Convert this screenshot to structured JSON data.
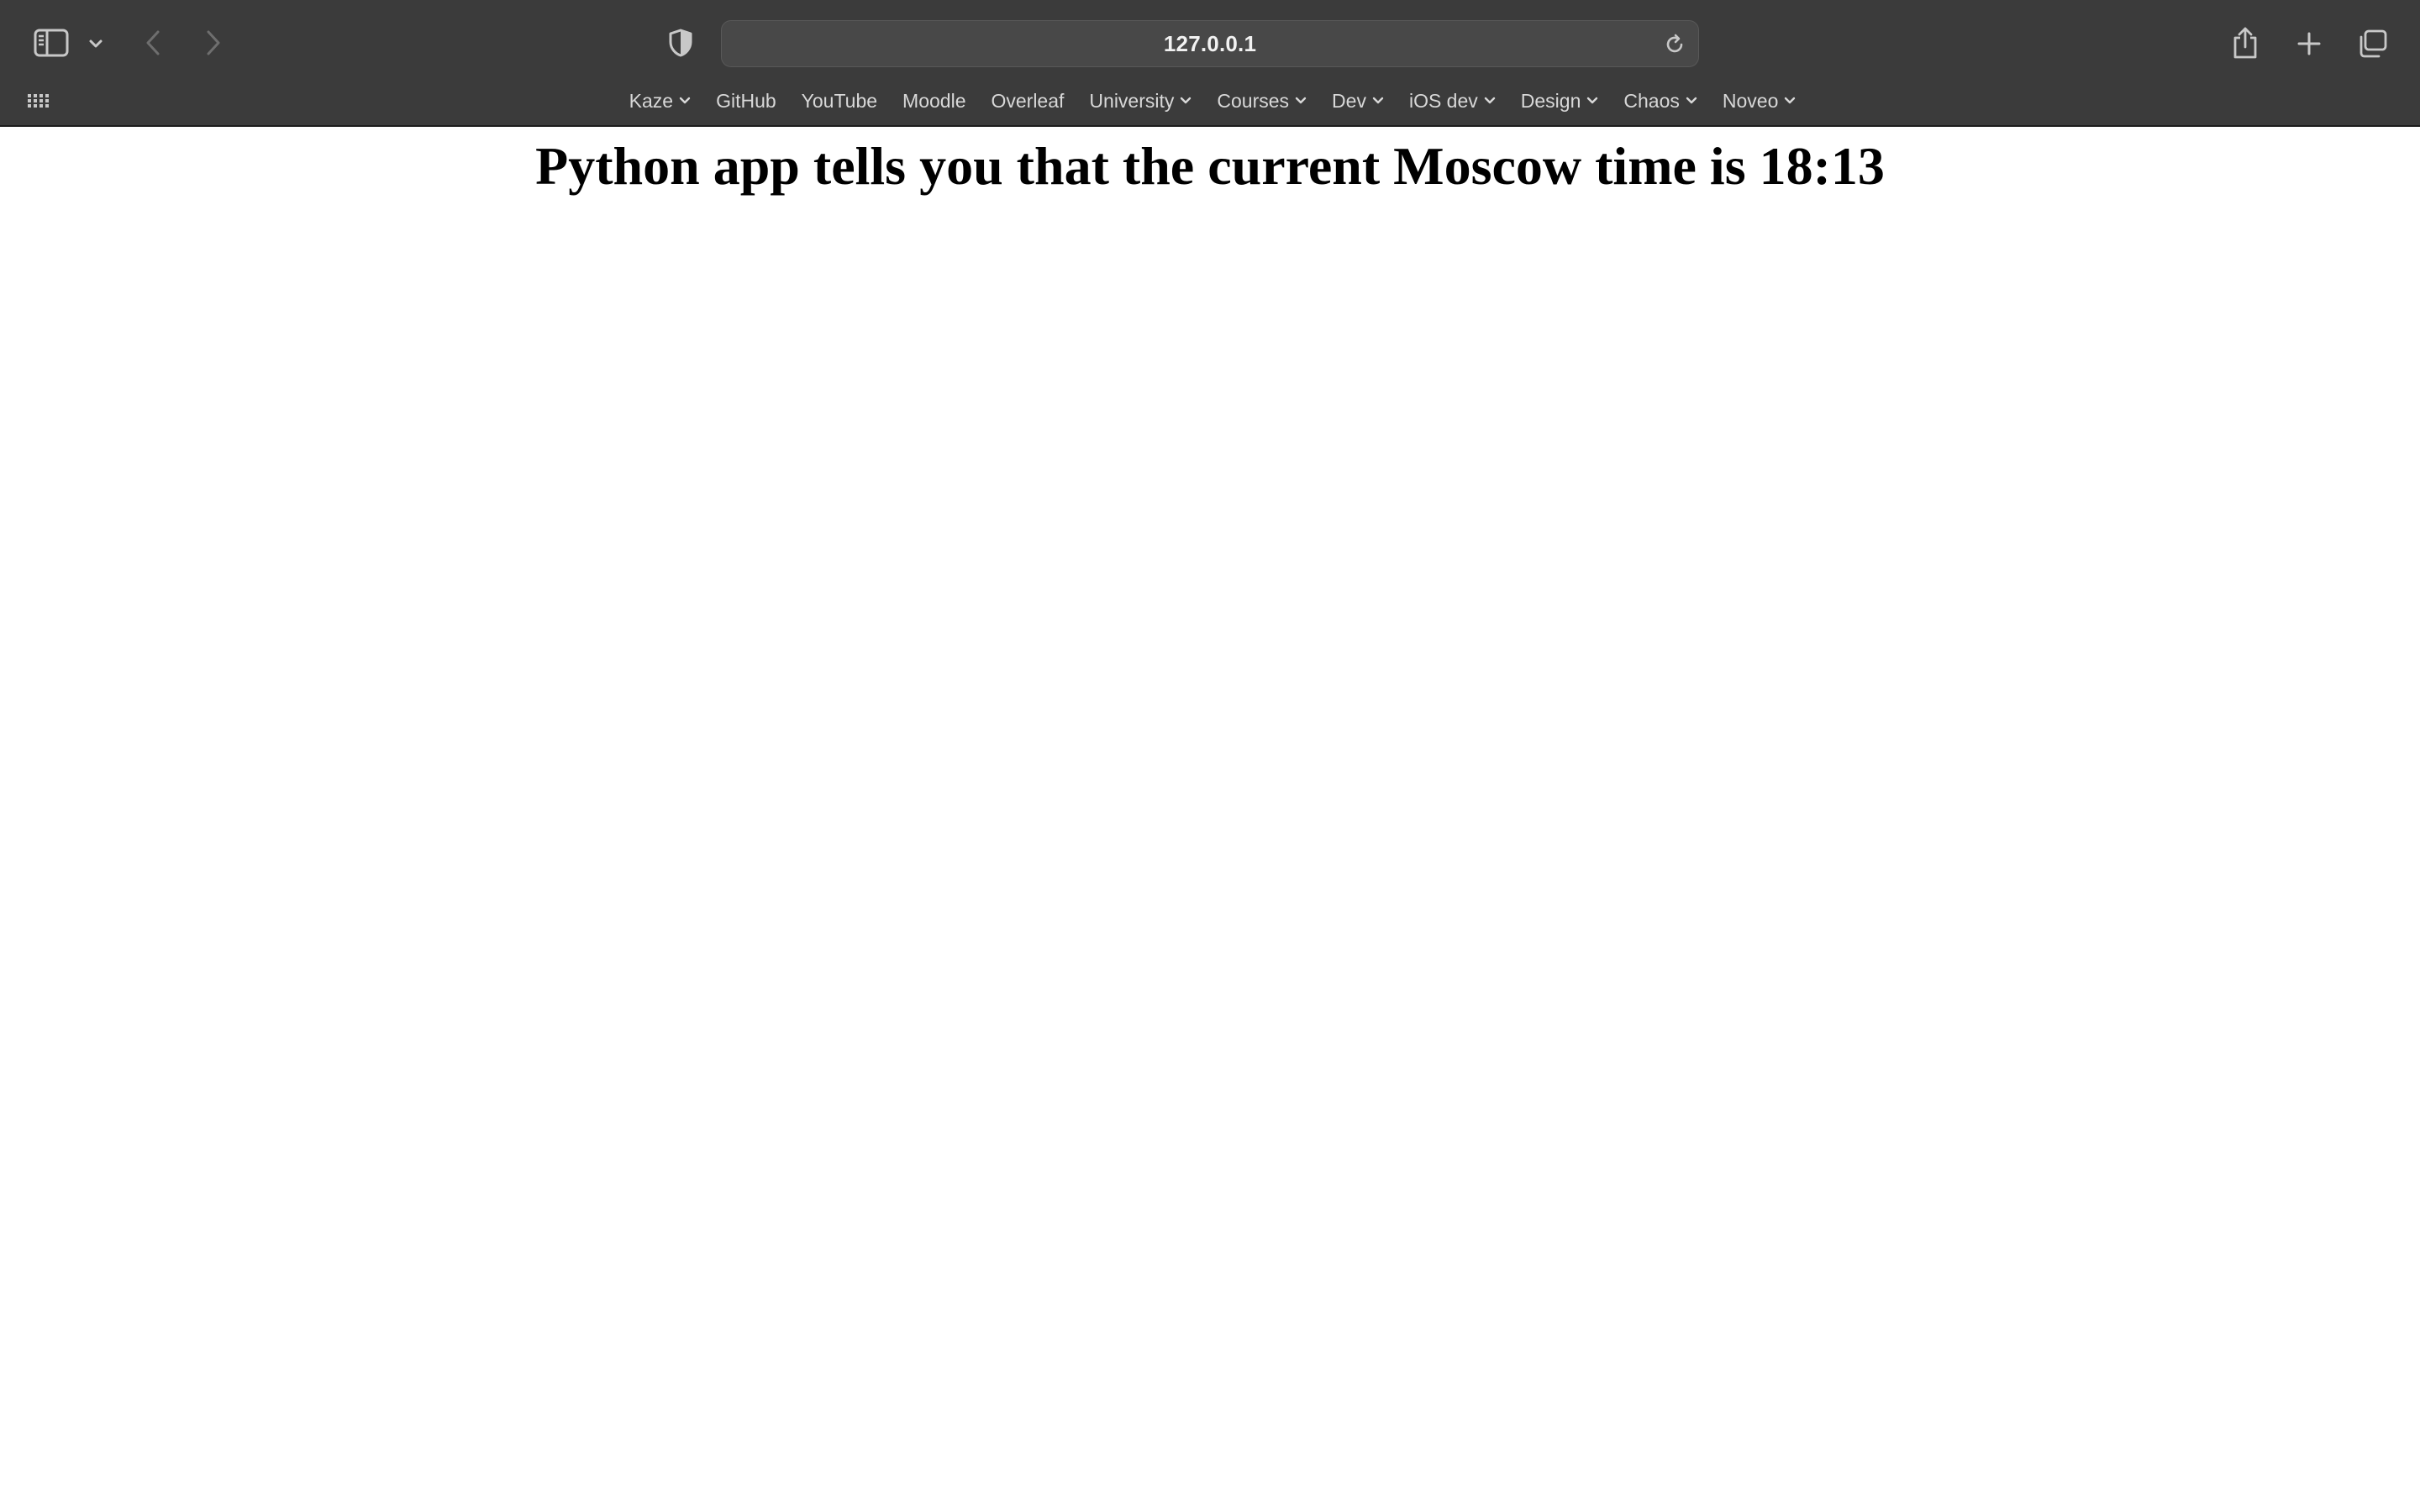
{
  "browser": {
    "url": "127.0.0.1",
    "favorites": [
      {
        "label": "Kaze",
        "has_menu": true
      },
      {
        "label": "GitHub",
        "has_menu": false
      },
      {
        "label": "YouTube",
        "has_menu": false
      },
      {
        "label": "Moodle",
        "has_menu": false
      },
      {
        "label": "Overleaf",
        "has_menu": false
      },
      {
        "label": "University",
        "has_menu": true
      },
      {
        "label": "Courses",
        "has_menu": true
      },
      {
        "label": "Dev",
        "has_menu": true
      },
      {
        "label": "iOS dev",
        "has_menu": true
      },
      {
        "label": "Design",
        "has_menu": true
      },
      {
        "label": "Chaos",
        "has_menu": true
      },
      {
        "label": "Noveo",
        "has_menu": true
      }
    ],
    "icons": {
      "sidebar": "sidebar-icon",
      "sidebar_menu": "chevron-down-icon",
      "back": "chevron-left-icon",
      "forward": "chevron-right-icon",
      "privacy": "shield-icon",
      "reload": "reload-icon",
      "share": "share-icon",
      "new_tab": "plus-icon",
      "tab_overview": "tabs-overview-icon",
      "favorites_grid": "grid-icon"
    },
    "colors": {
      "chrome_background": "#3b3b3b",
      "address_bar": "#484848",
      "icon": "#c8c8c8",
      "icon_disabled": "#6e6e6e",
      "favorites_text": "#d8d8d8"
    }
  },
  "page": {
    "heading": "Python app tells you that the current Moscow time is 18:13"
  }
}
